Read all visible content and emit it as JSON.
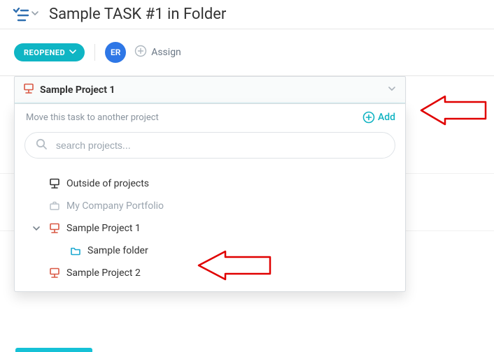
{
  "title": "Sample TASK #1 in Folder",
  "status": {
    "label": "REOPENED"
  },
  "avatar": {
    "initials": "ER"
  },
  "assign": {
    "label": "Assign"
  },
  "panel": {
    "project_name": "Sample Project 1",
    "move_label": "Move this task to another project",
    "add_label": "Add"
  },
  "search": {
    "placeholder": "search projects..."
  },
  "tree": {
    "outside": "Outside of projects",
    "portfolio": "My Company Portfolio",
    "sp1": "Sample Project 1",
    "folder": "Sample folder",
    "sp2": "Sample Project 2"
  }
}
